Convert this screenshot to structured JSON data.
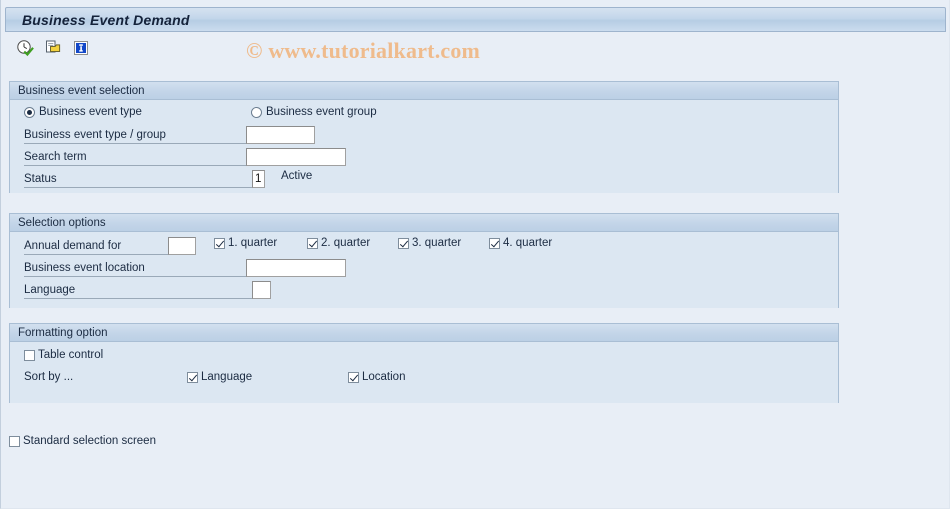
{
  "window": {
    "title": "Business Event Demand"
  },
  "watermark": {
    "text": "© www.tutorialkart.com",
    "color": "#efbb8c"
  },
  "toolbar": {
    "buttons": [
      {
        "name": "execute-icon",
        "tooltip": "Execute"
      },
      {
        "name": "execute-background-icon",
        "tooltip": "Execute in Background"
      },
      {
        "name": "info-icon",
        "tooltip": "Information"
      }
    ]
  },
  "groups": {
    "selection": {
      "title": "Business event selection",
      "radios": [
        {
          "label": "Business event type",
          "selected": true
        },
        {
          "label": "Business event group",
          "selected": false
        }
      ],
      "fields": [
        {
          "label": "Business event type / group",
          "value": "",
          "placeholder": ""
        },
        {
          "label": "Search term",
          "value": "",
          "placeholder": ""
        },
        {
          "label": "Status",
          "value": "1",
          "placeholder": "",
          "suffix": "Active"
        }
      ],
      "multiple_selection_button": "multiple-selection-icon"
    },
    "options": {
      "title": "Selection options",
      "annual_demand": {
        "label": "Annual demand for",
        "value": "",
        "quarters": [
          {
            "label": "1. quarter",
            "checked": true
          },
          {
            "label": "2. quarter",
            "checked": true
          },
          {
            "label": "3. quarter",
            "checked": true
          },
          {
            "label": "4. quarter",
            "checked": true
          }
        ]
      },
      "fields": [
        {
          "label": "Business event location",
          "value": ""
        },
        {
          "label": "Language",
          "value": ""
        }
      ]
    },
    "formatting": {
      "title": "Formatting option",
      "table_control": {
        "label": "Table control",
        "checked": false
      },
      "sort_by": {
        "label": "Sort by ...",
        "items": [
          {
            "label": "Language",
            "checked": true
          },
          {
            "label": "Location",
            "checked": true
          }
        ]
      }
    }
  },
  "footer": {
    "standard_selection_screen": {
      "label": "Standard selection screen",
      "checked": false
    }
  },
  "colors": {
    "page_background": "#e8eef6",
    "group_background": "#dce7f2",
    "group_border": "#a9bed4",
    "title_text": "#14223a",
    "accent_yellow": "#f6e79a"
  }
}
